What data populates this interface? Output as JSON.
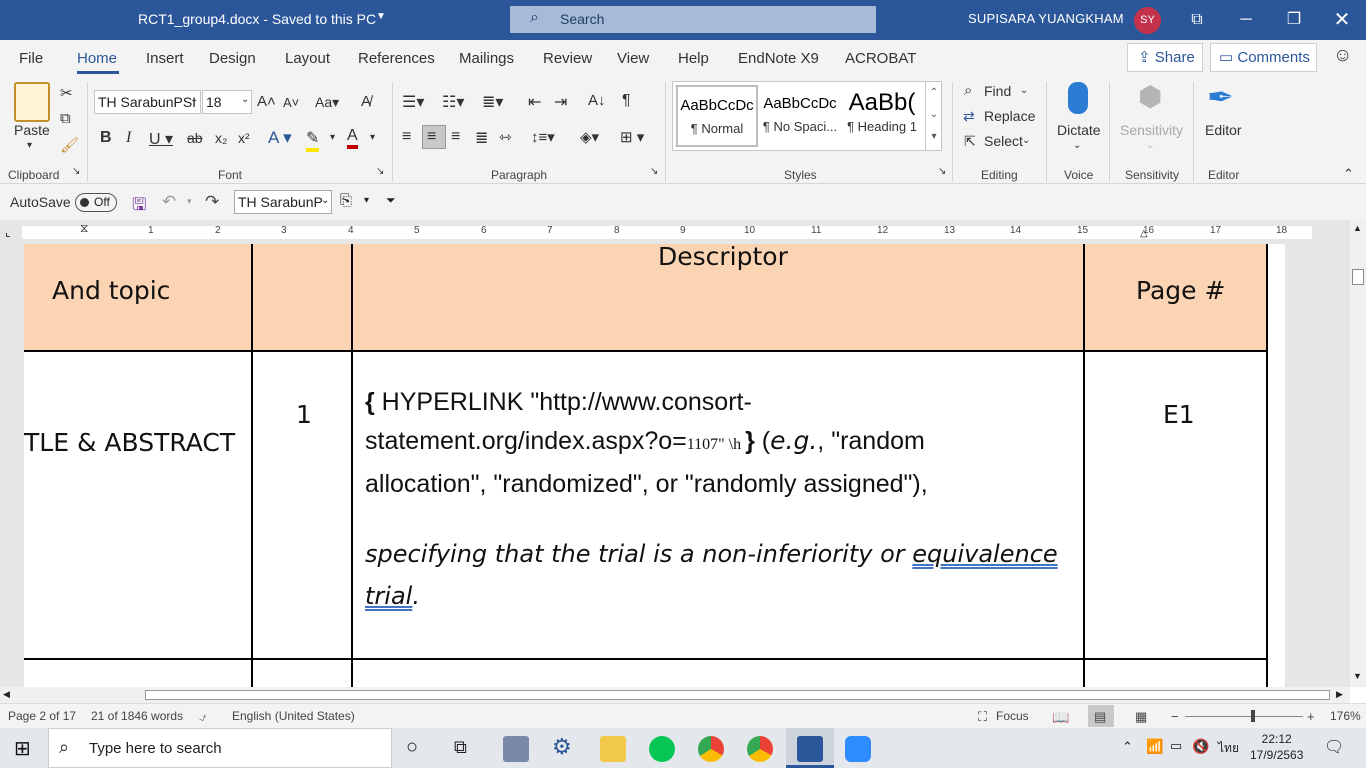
{
  "titlebar": {
    "doc_title": "RCT1_group4.docx  -  Saved to this PC",
    "search_label": "Search",
    "user_name": "SUPISARA YUANGKHAM",
    "avatar_initials": "SY"
  },
  "menu": {
    "file": "File",
    "tabs": [
      "Home",
      "Insert",
      "Design",
      "Layout",
      "References",
      "Mailings",
      "Review",
      "View",
      "Help",
      "EndNote X9",
      "ACROBAT"
    ],
    "active": "Home",
    "share": "Share",
    "comments": "Comments"
  },
  "ribbon": {
    "clipboard": {
      "label": "Clipboard",
      "paste": "Paste"
    },
    "font": {
      "label": "Font",
      "font_name": "TH SarabunPSI",
      "font_size": "18"
    },
    "paragraph": {
      "label": "Paragraph"
    },
    "styles": {
      "label": "Styles",
      "items": [
        {
          "preview": "AaBbCcDc",
          "name": "¶ Normal"
        },
        {
          "preview": "AaBbCcDc",
          "name": "¶ No Spaci..."
        },
        {
          "preview": "AaBb(",
          "name": "¶ Heading 1"
        }
      ]
    },
    "editing": {
      "label": "Editing",
      "find": "Find",
      "replace": "Replace",
      "select": "Select"
    },
    "voice": {
      "label": "Voice",
      "dictate": "Dictate"
    },
    "sensitivity": {
      "label": "Sensitivity",
      "button": "Sensitivity"
    },
    "editor": {
      "label": "Editor",
      "button": "Editor"
    }
  },
  "qat": {
    "autosave": "AutoSave",
    "toggle": "Off",
    "font_name": "TH SarabunP"
  },
  "ruler": {
    "numbers": [
      "1",
      "2",
      "3",
      "4",
      "5",
      "6",
      "7",
      "8",
      "9",
      "10",
      "11",
      "12",
      "13",
      "14",
      "15",
      "16",
      "17",
      "18"
    ]
  },
  "document": {
    "header": {
      "col1": "And topic",
      "col3": "Descriptor",
      "col4": "Page #"
    },
    "row": {
      "section": "TLE & ABSTRACT",
      "item": "1",
      "line1_brace": "{",
      "line1": " HYPERLINK \"http://www.consort-",
      "line2_a": "statement.org/index.aspx?o=",
      "line2_num": "1107",
      "line2_b": "\" \\h ",
      "line2_brace": "}",
      "line2_c": " (",
      "line2_eg": "e.g.",
      "line2_d": ", \"random",
      "line3": "allocation\", \"randomized\", or \"randomly assigned\"),",
      "line4_a": "specifying that the trial is a non-inferiority or ",
      "line4_link": "equivalence",
      "line5_link": "trial",
      "line5_end": ".",
      "page": "E1"
    }
  },
  "status": {
    "page": "Page 2 of 17",
    "words": "21 of 1846 words",
    "language": "English (United States)",
    "focus": "Focus",
    "zoom": "176%"
  },
  "taskbar": {
    "search_placeholder": "Type here to search",
    "lang": "ไทย",
    "time": "22:12",
    "date": "17/9/2563"
  }
}
